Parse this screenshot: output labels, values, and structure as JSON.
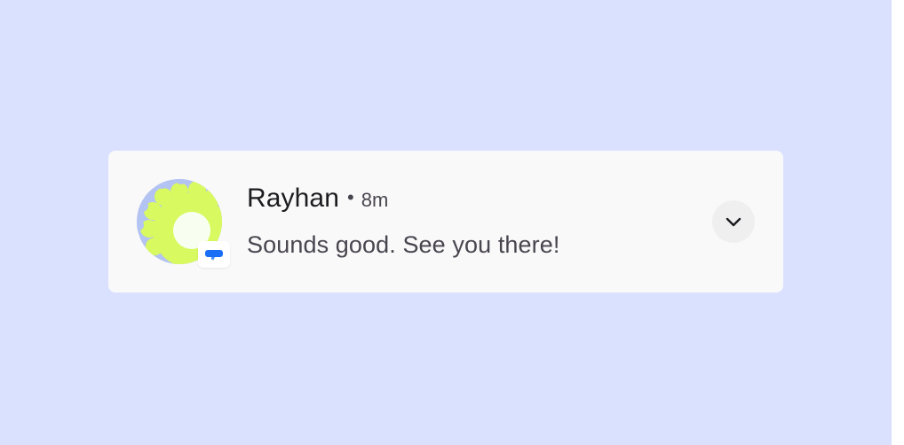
{
  "notification": {
    "sender": "Rayhan",
    "separator": "•",
    "time": "8m",
    "message": "Sounds good. See you there!",
    "avatar_icon": "contact-avatar",
    "app_icon": "messages-app-icon",
    "expand_icon": "chevron-down-icon"
  },
  "colors": {
    "background": "#d9e1ff",
    "card": "#f9f9f9",
    "avatar_yellow": "#d8f95f",
    "avatar_blue": "#b3c3f2",
    "app_icon_blue": "#1a6ef5",
    "expand_button_bg": "#efefef"
  }
}
